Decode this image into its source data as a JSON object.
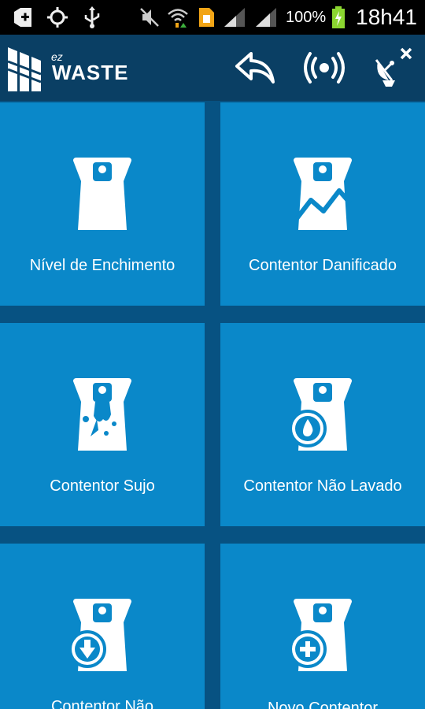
{
  "status_bar": {
    "battery_percent": "100%",
    "time": "18h41",
    "icons": [
      "plus-box-icon",
      "gps-icon",
      "usb-icon",
      "mute-icon",
      "wifi-icon",
      "file-icon",
      "signal-icon",
      "signal-icon",
      "battery-charging-icon"
    ]
  },
  "app_bar": {
    "logo_ez": "ez",
    "logo_waste": "WASTE",
    "actions": [
      "back-arrow-icon",
      "broadcast-icon",
      "satellite-dish-off-icon"
    ]
  },
  "tiles": [
    {
      "label": "Nível de Enchimento",
      "icon": "bin-fill-level-icon"
    },
    {
      "label": "Contentor Danificado",
      "icon": "bin-damaged-icon"
    },
    {
      "label": "Contentor Sujo",
      "icon": "bin-dirty-icon"
    },
    {
      "label": "Contentor Não Lavado",
      "icon": "bin-unwashed-icon"
    },
    {
      "label": "Contentor Não",
      "icon": "bin-download-icon"
    },
    {
      "label": "Novo Contentor",
      "icon": "bin-add-icon"
    }
  ],
  "colors": {
    "status_bar": "#000000",
    "app_bar": "#0a3f64",
    "background": "#075282",
    "tile": "#0a88c9",
    "text": "#ffffff"
  }
}
